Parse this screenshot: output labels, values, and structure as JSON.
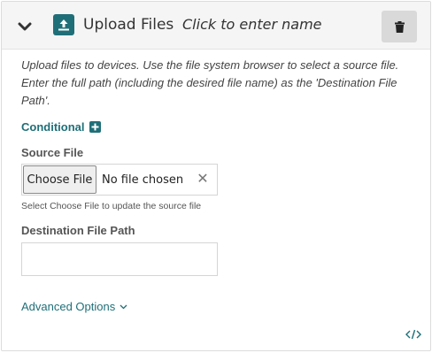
{
  "step": {
    "title": "Upload Files",
    "name_placeholder": "Click to enter name",
    "icon": "upload-icon",
    "accent_color": "#1f6f78"
  },
  "description": "Upload files to devices. Use the file system browser to select a source file. Enter the full path (including the desired file name) as the 'Destination File Path'.",
  "conditional": {
    "label": "Conditional",
    "icon": "plus-icon"
  },
  "source_file": {
    "label": "Source File",
    "choose_button": "Choose File",
    "status": "No file chosen",
    "clear_symbol": "✕",
    "hint": "Select Choose File to update the source file"
  },
  "destination": {
    "label": "Destination File Path",
    "value": ""
  },
  "advanced": {
    "label": "Advanced Options"
  }
}
